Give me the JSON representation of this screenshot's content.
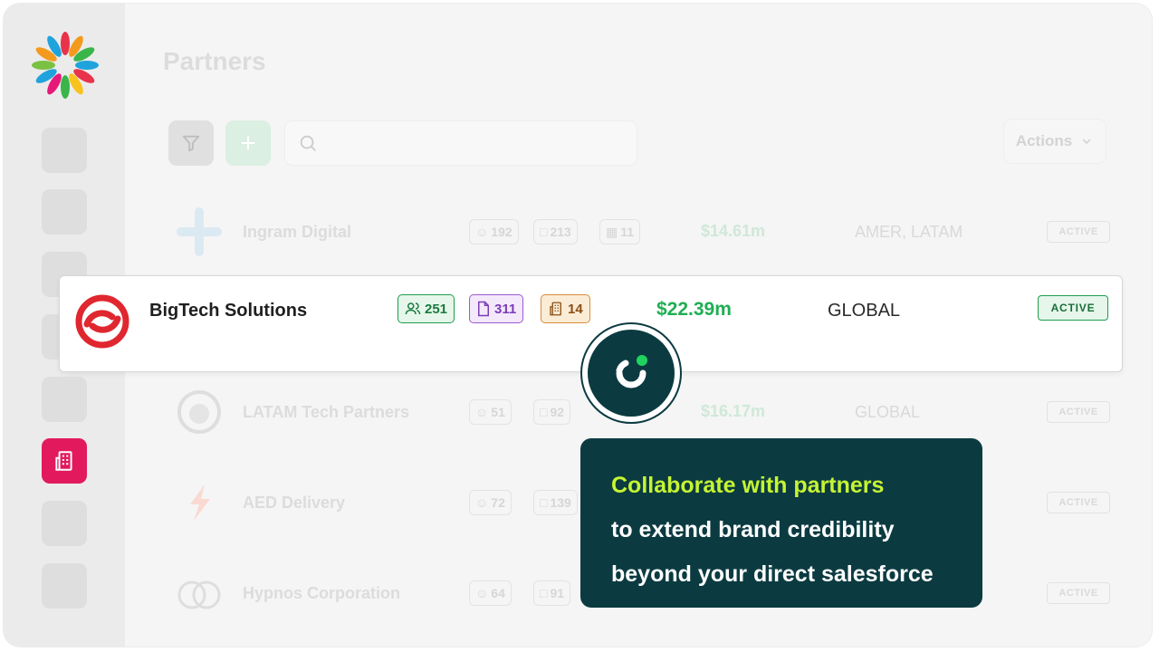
{
  "page": {
    "title": "Partners"
  },
  "toolbar": {
    "search_placeholder": "",
    "actions_label": "Actions"
  },
  "colors": {
    "accent": "#1fae54",
    "nav_active": "#e21a5d",
    "callout_bg": "#0b3b41",
    "callout_highlight": "#c6f432"
  },
  "rows": [
    {
      "name": "Ingram Digital",
      "contacts": "192",
      "docs": "213",
      "buildings": "11",
      "value": "$14.61m",
      "region": "AMER, LATAM",
      "status": "ACTIVE"
    },
    {
      "name": "LATAM Tech Partners",
      "contacts": "51",
      "docs": "92",
      "value": "$16.17m",
      "region": "GLOBAL",
      "status": "ACTIVE"
    },
    {
      "name": "AED Delivery",
      "contacts": "72",
      "docs": "139",
      "status": "ACTIVE"
    },
    {
      "name": "Hypnos Corporation",
      "contacts": "64",
      "docs": "91",
      "status": "ACTIVE"
    }
  ],
  "highlight": {
    "name": "BigTech Solutions",
    "contacts": "251",
    "docs": "311",
    "buildings": "14",
    "value": "$22.39m",
    "region": "GLOBAL",
    "status": "ACTIVE"
  },
  "callout": {
    "line1": "Collaborate with partners",
    "line2": "to extend brand credibility",
    "line3": "beyond your direct salesforce"
  }
}
